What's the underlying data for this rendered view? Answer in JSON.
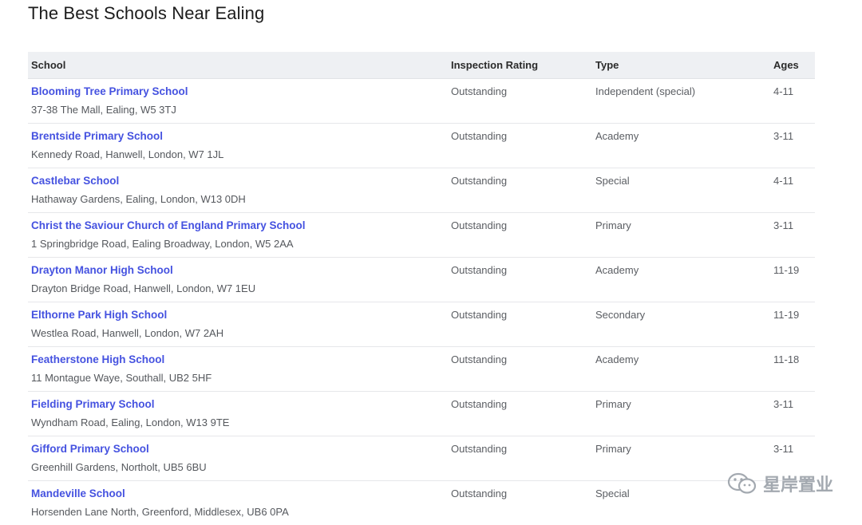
{
  "page": {
    "title": "The Best Schools Near Ealing"
  },
  "table": {
    "headers": {
      "school": "School",
      "rating": "Inspection Rating",
      "type": "Type",
      "ages": "Ages"
    },
    "rows": [
      {
        "name": "Blooming Tree Primary School",
        "address": "37-38 The Mall, Ealing, W5 3TJ",
        "rating": "Outstanding",
        "type": "Independent (special)",
        "ages": "4-11"
      },
      {
        "name": "Brentside Primary School",
        "address": "Kennedy Road, Hanwell, London, W7 1JL",
        "rating": "Outstanding",
        "type": "Academy",
        "ages": "3-11"
      },
      {
        "name": "Castlebar School",
        "address": "Hathaway Gardens, Ealing, London, W13 0DH",
        "rating": "Outstanding",
        "type": "Special",
        "ages": "4-11"
      },
      {
        "name": "Christ the Saviour Church of England Primary School",
        "address": "1 Springbridge Road, Ealing Broadway, London, W5 2AA",
        "rating": "Outstanding",
        "type": "Primary",
        "ages": "3-11"
      },
      {
        "name": "Drayton Manor High School",
        "address": "Drayton Bridge Road, Hanwell, London, W7 1EU",
        "rating": "Outstanding",
        "type": "Academy",
        "ages": "11-19"
      },
      {
        "name": "Elthorne Park High School",
        "address": "Westlea Road, Hanwell, London, W7 2AH",
        "rating": "Outstanding",
        "type": "Secondary",
        "ages": "11-19"
      },
      {
        "name": "Featherstone High School",
        "address": "11 Montague Waye, Southall, UB2 5HF",
        "rating": "Outstanding",
        "type": "Academy",
        "ages": "11-18"
      },
      {
        "name": "Fielding Primary School",
        "address": "Wyndham Road, Ealing, London, W13 9TE",
        "rating": "Outstanding",
        "type": "Primary",
        "ages": "3-11"
      },
      {
        "name": "Gifford Primary School",
        "address": "Greenhill Gardens, Northolt, UB5 6BU",
        "rating": "Outstanding",
        "type": "Primary",
        "ages": "3-11"
      },
      {
        "name": "Mandeville School",
        "address": "Horsenden Lane North, Greenford, Middlesex, UB6 0PA",
        "rating": "Outstanding",
        "type": "Special",
        "ages": ""
      }
    ]
  },
  "watermark": {
    "text": "星岸置业",
    "icon": "wechat-icon",
    "color": "#9aa0a8"
  },
  "colors": {
    "link": "#4552e0",
    "header_bg": "#eef0f3"
  }
}
